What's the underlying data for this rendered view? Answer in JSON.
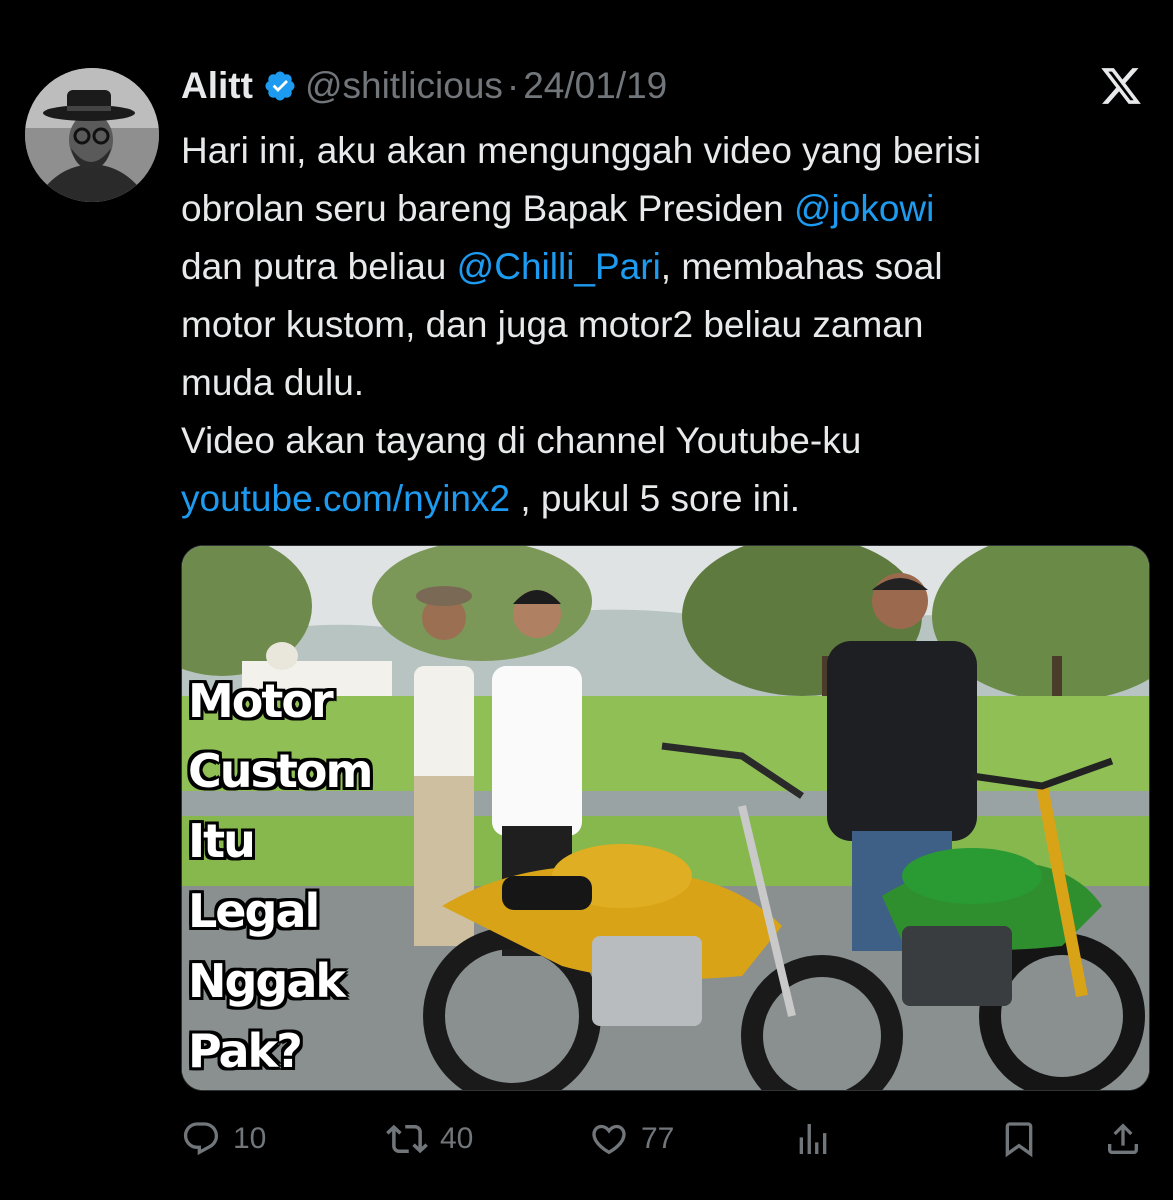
{
  "tweet": {
    "display_name": "Alitt",
    "handle": "@shitlicious",
    "separator": "·",
    "date": "24/01/19",
    "text_lines": [
      [
        {
          "t": "Hari ini, aku akan mengunggah video yang berisi",
          "link": false
        }
      ],
      [
        {
          "t": "obrolan seru bareng Bapak Presiden ",
          "link": false
        },
        {
          "t": "@jokowi",
          "link": true
        }
      ],
      [
        {
          "t": "dan putra beliau ",
          "link": false
        },
        {
          "t": "@Chilli_Pari",
          "link": true
        },
        {
          "t": ", membahas soal",
          "link": false
        }
      ],
      [
        {
          "t": "motor kustom, dan juga motor2 beliau zaman",
          "link": false
        }
      ],
      [
        {
          "t": "muda dulu.",
          "link": false
        }
      ],
      [
        {
          "t": "Video akan tayang di channel Youtube-ku",
          "link": false
        }
      ],
      [
        {
          "t": "youtube.com/nyinx2",
          "link": true
        },
        {
          "t": " , pukul 5 sore ini.",
          "link": false
        }
      ]
    ],
    "media_overlay_lines": [
      "Motor",
      "Custom",
      "Itu",
      "Legal",
      "Nggak",
      "Pak?"
    ],
    "metrics": {
      "replies": "10",
      "reposts": "40",
      "likes": "77"
    }
  },
  "icons": {
    "verified": "verified-badge-icon",
    "platform": "x-logo-icon",
    "reply": "reply-icon",
    "repost": "repost-icon",
    "like": "heart-icon",
    "views": "views-bar-chart-icon",
    "bookmark": "bookmark-icon",
    "share": "share-icon"
  },
  "colors": {
    "background": "#000000",
    "text": "#e7e9ea",
    "muted": "#71767b",
    "link": "#1d9bf0",
    "verified": "#1d9bf0"
  }
}
